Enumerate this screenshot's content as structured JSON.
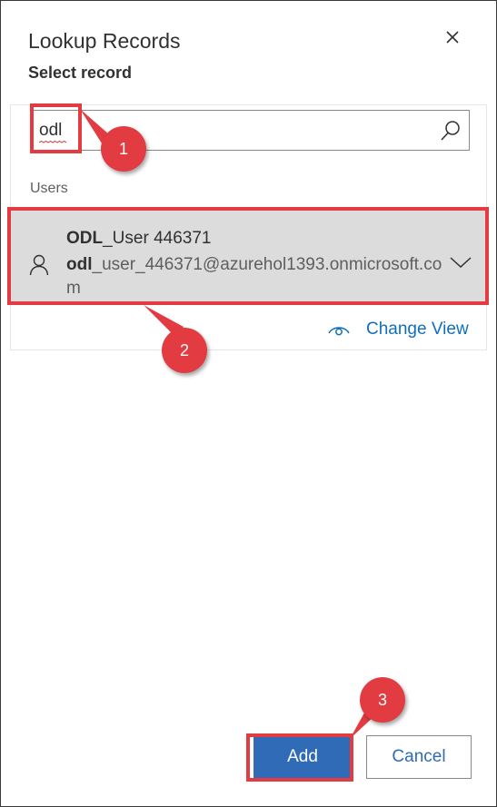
{
  "dialog": {
    "title": "Lookup Records",
    "subtitle": "Select record"
  },
  "search": {
    "value": "odl"
  },
  "results": {
    "section_label": "Users",
    "items": [
      {
        "name_match": "ODL",
        "name_rest": "_User 446371",
        "email_match": "odl",
        "email_rest": "_user_446371@azurehol1393.onmicrosoft.com"
      }
    ]
  },
  "change_view": {
    "label": "Change View"
  },
  "footer": {
    "add_label": "Add",
    "cancel_label": "Cancel"
  },
  "annotations": {
    "step1": "1",
    "step2": "2",
    "step3": "3"
  },
  "icons": {
    "close": "close-icon",
    "search": "search-icon",
    "person": "person-icon",
    "expand": "chevron-down-icon",
    "change_view": "eye-icon"
  },
  "colors": {
    "accent": "#2f6bb6",
    "link": "#106ebe",
    "highlight": "#e23b41",
    "selected_row": "#dcdcdc"
  }
}
